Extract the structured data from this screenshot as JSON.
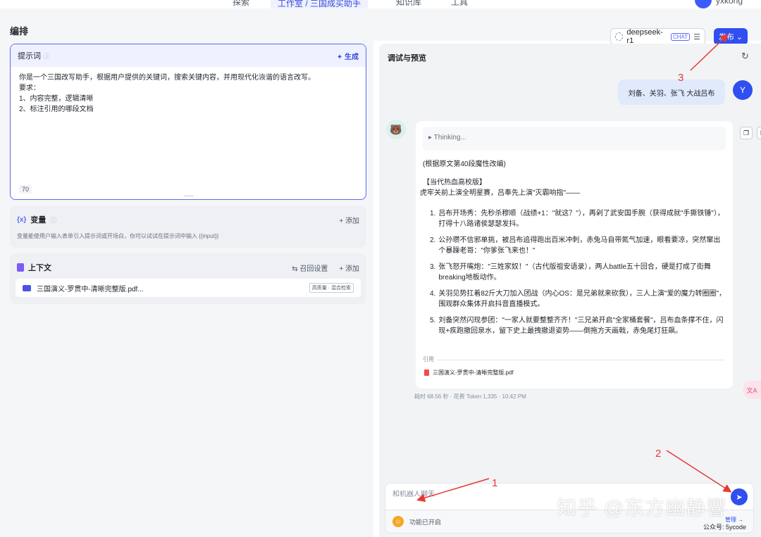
{
  "topnav": {
    "items": [
      "探索",
      "工作室 / 三国成买助手",
      "知识库",
      "工具"
    ],
    "user": "yxkong"
  },
  "header": {
    "title": "编排",
    "model": "deepseek-r1",
    "model_tag": "CHAT",
    "publish": "发布"
  },
  "prompt": {
    "title": "提示词",
    "generate": "生成",
    "lines": [
      "你是一个三国改写助手，根据用户提供的关键词，搜索关键内容，并用现代化诙谐的语言改写。",
      "要求：",
      "1、内容完整，逻辑清晰",
      "2、标注引用的哪段文档"
    ],
    "count": "70"
  },
  "variables": {
    "title": "变量",
    "add": "+ 添加",
    "desc": "变量能使用户输入表单引入提示词或开场白，你可以试试在提示词中输入 {{input}}"
  },
  "context": {
    "title": "上下文",
    "recall": "召回设置",
    "add": "+ 添加",
    "file": "三国演义-罗贯中-清晰完整版.pdf...",
    "file_tag": "高质量 · 混合检索"
  },
  "preview": {
    "title": "调试与预览",
    "user_msg": "刘备、关羽、张飞 大战吕布",
    "user_initial": "Y",
    "thinking": "▸  Thinking...",
    "source_note": "(根据原文第40段魔性改编)",
    "version_title": "【当代热血高校版】",
    "intro": "虎牢关前上演全明星赛，吕奉先上演\"灭霸响指\"——",
    "items": [
      "吕布开场秀：先秒杀穆顺（战绩+1：\"就这？\"），再剁了武安国手腕（获得成就\"手撕铁锤\"），打得十八路诸侯瑟瑟发抖。",
      "公孙瓒不信邪单挑，被吕布追得跑出百米冲刺，赤兔马自带氮气加速，眼看要凉，突然窜出个暴躁老哥：\"你爹张飞来也！\"",
      "张飞怒开嘴炮：\"三姓家奴！\"（古代版祖安语录），两人battle五十回合，硬是打成了街舞breaking地板动作。",
      "关羽见势扛着82斤大刀加入团战（内心OS：是兄弟就来砍我），三人上演\"爱的魔力转圈圈\"，围观群众集体开启抖音直播模式。",
      "刘备突然闪现参团：\"一家人就要整整齐齐！\"三兄弟开启\"全家桶套餐\"，吕布血条撑不住，闪现+疾跑撤回泉水，留下史上最拽撤退姿势——倒拖方天画戟，赤兔尾灯狂飙。"
    ],
    "cite_label": "引用",
    "cite_file": "三国演义-罗贯中-清晰完整版.pdf",
    "meta": "耗时 68.56 秒 · 花费 Token 1,335 · 10:42 PM",
    "input_placeholder": "和机器人聊天",
    "feature": "功能已开启",
    "manage": "管理 →"
  },
  "annotations": {
    "a1": "1",
    "a2": "2",
    "a3": "3"
  },
  "watermark": {
    "main": "知乎 @东方幽静響",
    "sub": "公众号: 5ycode"
  },
  "colors": {
    "accent": "#2f4ff0",
    "annotation": "#e53935",
    "prompt_border": "#5b6af5"
  }
}
